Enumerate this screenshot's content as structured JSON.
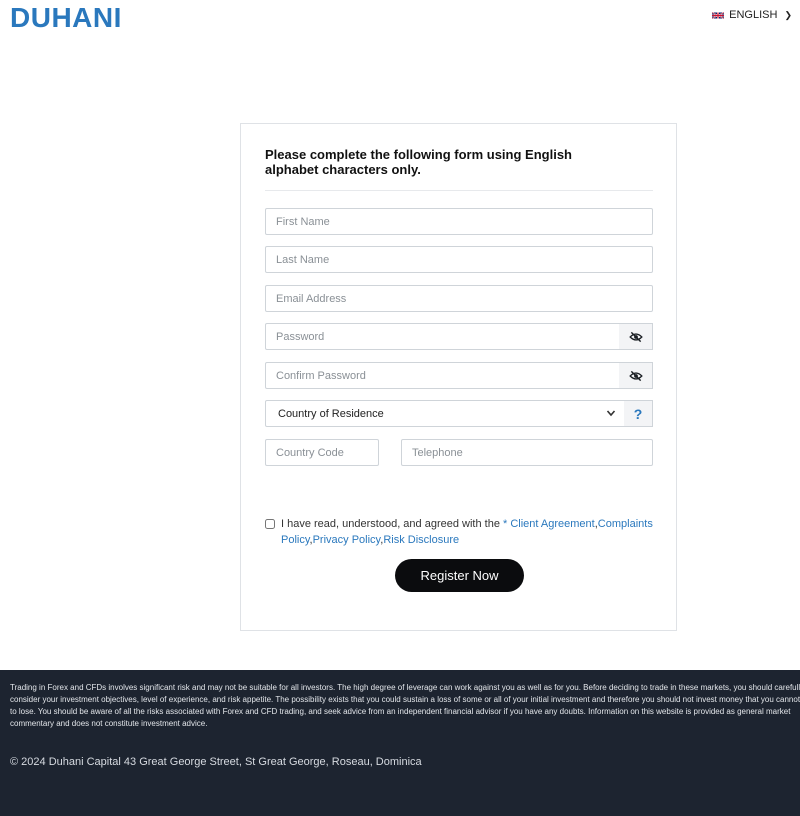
{
  "header": {
    "logo": "DUHANI",
    "language": "ENGLISH"
  },
  "form": {
    "instructions": "Please complete the following form using English alphabet characters only.",
    "fields": {
      "first_name": "First Name",
      "last_name": "Last Name",
      "email": "Email Address",
      "password": "Password",
      "confirm_password": "Confirm Password",
      "country_code": "Country Code",
      "telephone": "Telephone"
    },
    "country_select": "Country of Residence",
    "help": "?",
    "agreement": {
      "prefix": "I have read, understood, and agreed with the ",
      "asterisk": "* ",
      "client_agreement": "Client Agreement",
      "complaints": "Complaints Policy",
      "privacy": "Privacy Policy",
      "risk": "Risk Disclosure"
    },
    "register_label": "Register Now"
  },
  "footer": {
    "disclaimer": "Trading in Forex and CFDs involves significant risk and may not be suitable for all investors. The high degree of leverage can work against you as well as for you. Before deciding to trade in these markets, you should carefully consider your investment objectives, level of experience, and risk appetite. The possibility exists that you could sustain a loss of some or all of your initial investment and therefore you should not invest money that you cannot afford to lose. You should be aware of all the risks associated with Forex and CFD trading, and seek advice from an independent financial advisor if you have any doubts. Information on this website is provided as general market commentary and does not constitute investment advice.",
    "copyright": "© 2024 Duhani Capital 43 Great George Street, St Great George, Roseau, Dominica"
  },
  "colors": {
    "accent": "#2a78bd",
    "button": "#0b0c0e",
    "footer_bg": "#1d2430"
  },
  "icons": {
    "language_flag": "uk-flag-icon",
    "password_toggle": "eye-slash-icon",
    "select_caret": "chevron-down-icon"
  }
}
